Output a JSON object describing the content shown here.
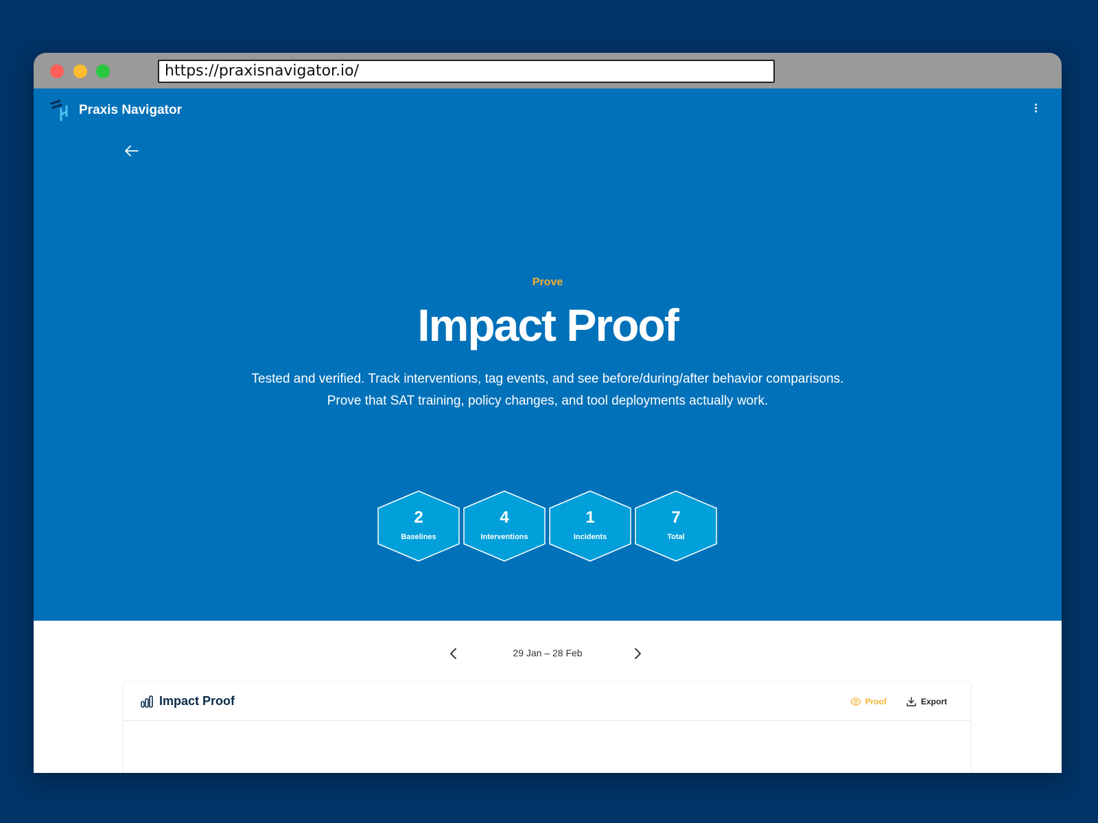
{
  "browser": {
    "url": "https://praxisnavigator.io/"
  },
  "header": {
    "brand_name": "Praxis Navigator",
    "menu_icon": "kebab-menu-icon",
    "back_icon": "arrow-left-icon"
  },
  "hero": {
    "eyebrow": "Prove",
    "title": "Impact Proof",
    "description": "Tested and verified. Track interventions, tag events, and see before/during/after behavior comparisons. Prove that SAT training, policy changes, and tool deployments actually work.",
    "stats": [
      {
        "value": "2",
        "label": "Baselines"
      },
      {
        "value": "4",
        "label": "Interventions"
      },
      {
        "value": "1",
        "label": "Incidents"
      },
      {
        "value": "7",
        "label": "Total"
      }
    ]
  },
  "date_nav": {
    "range": "29 Jan – 28 Feb"
  },
  "card": {
    "title": "Impact Proof",
    "icon": "bar-chart-icon",
    "proof_label": "Proof",
    "export_label": "Export"
  },
  "colors": {
    "page_bg": "#003366",
    "hero_bg": "#0171b9",
    "hex_fill": "#02a0da",
    "accent": "#f5b12e",
    "card_title": "#0b2a4a"
  }
}
